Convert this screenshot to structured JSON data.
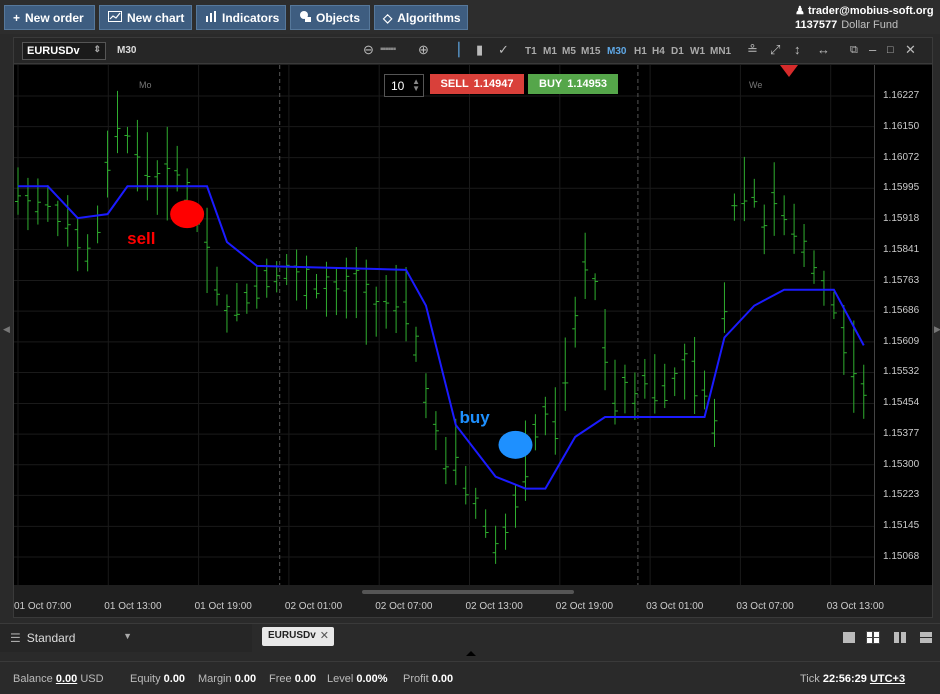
{
  "toolbar": {
    "new_order": "New order",
    "new_chart": "New chart",
    "indicators": "Indicators",
    "objects": "Objects",
    "algorithms": "Algorithms"
  },
  "account": {
    "user": "trader@mobius-soft.org",
    "number": "1137577",
    "fund": "Dollar Fund"
  },
  "chart_toolbar": {
    "symbol": "EURUSDv",
    "timeframe": "M30",
    "timeframes": [
      "T1",
      "M1",
      "M5",
      "M15",
      "M30",
      "H1",
      "H4",
      "D1",
      "W1",
      "MN1"
    ],
    "active_timeframe": "M30"
  },
  "order_panel": {
    "quantity": "10",
    "sell_label": "SELL",
    "sell_price": "1.14947",
    "buy_label": "BUY",
    "buy_price": "1.14953"
  },
  "day_markers": {
    "mo": "Mo",
    "we": "We"
  },
  "annotations": {
    "sell": "sell",
    "buy": "buy"
  },
  "chart_data": {
    "type": "candlestick",
    "symbol": "EURUSDv",
    "timeframe": "M30",
    "y_ticks": [
      "1.16227",
      "1.16150",
      "1.16072",
      "1.15995",
      "1.15918",
      "1.15841",
      "1.15763",
      "1.15686",
      "1.15609",
      "1.15532",
      "1.15454",
      "1.15377",
      "1.15300",
      "1.15223",
      "1.15145",
      "1.15068"
    ],
    "x_ticks": [
      "01 Oct 07:00",
      "01 Oct 13:00",
      "01 Oct 19:00",
      "02 Oct 01:00",
      "02 Oct 07:00",
      "02 Oct 13:00",
      "02 Oct 19:00",
      "03 Oct 01:00",
      "03 Oct 07:00",
      "03 Oct 13:00"
    ],
    "ylim": [
      1.15,
      1.163
    ],
    "indicator_line": [
      [
        0,
        1.16
      ],
      [
        3,
        1.16
      ],
      [
        6,
        1.1592
      ],
      [
        9,
        1.1593
      ],
      [
        11,
        1.16
      ],
      [
        19,
        1.16
      ],
      [
        21,
        1.1586
      ],
      [
        24,
        1.158
      ],
      [
        39,
        1.1579
      ],
      [
        41,
        1.157
      ],
      [
        44,
        1.154
      ],
      [
        48,
        1.1527
      ],
      [
        51,
        1.1524
      ],
      [
        53,
        1.1524
      ],
      [
        56,
        1.1537
      ],
      [
        59,
        1.1542
      ],
      [
        69,
        1.1542
      ],
      [
        71,
        1.1562
      ],
      [
        74,
        1.157
      ],
      [
        77,
        1.1574
      ],
      [
        82,
        1.1574
      ],
      [
        85,
        1.156
      ]
    ],
    "annotations": [
      {
        "text": "sell",
        "color": "#ff0000",
        "x": 17,
        "y": 1.1593
      },
      {
        "text": "buy",
        "color": "#1e90ff",
        "x": 50,
        "y": 1.1535
      }
    ],
    "vertical_separators": [
      26,
      62
    ]
  },
  "bottom": {
    "workspace": "Standard",
    "tab": "EURUSDv"
  },
  "status": {
    "balance_label": "Balance",
    "balance": "0.00",
    "currency": "USD",
    "equity_label": "Equity",
    "equity": "0.00",
    "margin_label": "Margin",
    "margin": "0.00",
    "free_label": "Free",
    "free": "0.00",
    "level_label": "Level",
    "level": "0.00%",
    "profit_label": "Profit",
    "profit": "0.00",
    "tick_label": "Tick",
    "time": "22:56:29",
    "tz": "UTC+3"
  },
  "colors": {
    "candle": "#2fae2f",
    "indicator": "#1b1bff",
    "sell": "#d9403a",
    "buy": "#55a64a"
  }
}
